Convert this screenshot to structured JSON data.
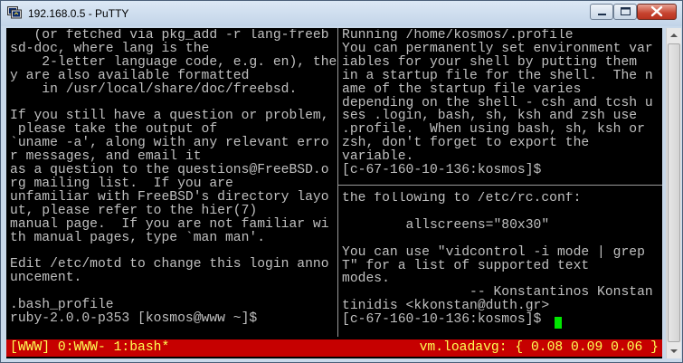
{
  "window": {
    "title": "192.168.0.5 - PuTTY"
  },
  "panes": {
    "left": [
      "   (or fetched via pkg_add -r lang-freeb",
      "sd-doc, where lang is the",
      "    2-letter language code, e.g. en), the",
      "y are also available formatted",
      "    in /usr/local/share/doc/freebsd.",
      "",
      "If you still have a question or problem,",
      " please take the output of",
      "`uname -a', along with any relevant erro",
      "r messages, and email it",
      "as a question to the questions@FreeBSD.o",
      "rg mailing list.  If you are",
      "unfamiliar with FreeBSD's directory layo",
      "ut, please refer to the hier(7)",
      "manual page.  If you are not familiar wi",
      "th manual pages, type `man man'.",
      "",
      "Edit /etc/motd to change this login anno",
      "uncement.",
      "",
      ".bash_profile",
      "ruby-2.0.0-p353 [kosmos@www ~]$"
    ],
    "top_right": [
      "Running /home/kosmos/.profile",
      "You can permanently set environment var",
      "iables for your shell by putting them",
      "in a startup file for the shell.  The n",
      "ame of the startup file varies",
      "depending on the shell - csh and tcsh u",
      "ses .login, bash, sh, ksh and zsh use",
      ".profile.  When using bash, sh, ksh or",
      "zsh, don't forget to export the",
      "variable.",
      "[c-67-160-10-136:kosmos]$"
    ],
    "bottom_right": [
      "the following to /etc/rc.conf:",
      "",
      "        allscreens=\"80x30\"",
      "",
      "You can use \"vidcontrol -i mode | grep",
      "T\" for a list of supported text",
      "modes.",
      "                -- Konstantinos Konstan",
      "tinidis <kkonstan@duth.gr>",
      "[c-67-160-10-136:kosmos]$"
    ]
  },
  "status_bar": {
    "left": "[WWW] 0:WWW- 1:bash*",
    "right": "vm.loadavg: { 0.08 0.09 0.06 }"
  },
  "colors": {
    "terminal_bg": "#000000",
    "terminal_fg": "#c0c0c0",
    "status_bg": "#c60000",
    "status_fg": "#ffff54",
    "cursor": "#00e600"
  },
  "icons": [
    "putty-app-icon",
    "minimize-icon",
    "maximize-icon",
    "close-icon",
    "scroll-up-icon",
    "scroll-down-icon"
  ]
}
